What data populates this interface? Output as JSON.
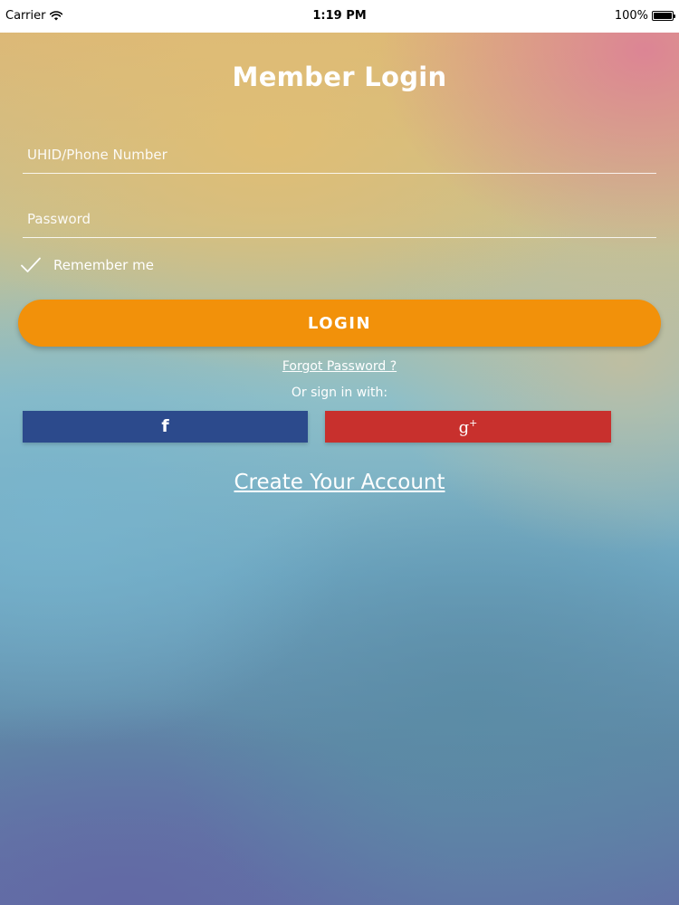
{
  "status_bar": {
    "carrier": "Carrier",
    "time": "1:19 PM",
    "battery": "100%"
  },
  "login": {
    "title": "Member Login",
    "phone_placeholder": "UHID/Phone Number",
    "password_placeholder": "Password",
    "remember_label": "Remember me",
    "login_button": "LOGIN",
    "forgot_link": "Forgot Password ?",
    "or_sign_in": "Or sign in with:",
    "create_account": "Create Your Account"
  },
  "social": {
    "facebook_color": "#2c4a8c",
    "google_color": "#c8302d"
  },
  "icons": {
    "wifi": "wifi-icon",
    "battery": "battery-icon",
    "check": "check-icon",
    "facebook": "facebook-icon",
    "google_plus": "google-plus-icon"
  },
  "colors": {
    "login_button": "#f2910a",
    "text": "#ffffff"
  }
}
